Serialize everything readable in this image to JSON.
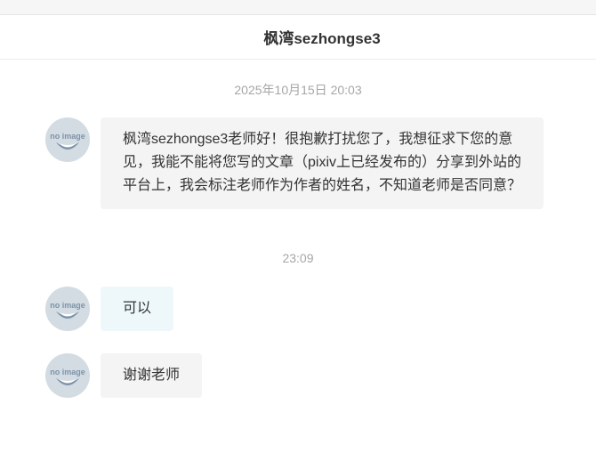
{
  "header": {
    "title": "枫湾sezhongse3"
  },
  "messages": [
    {
      "timestamp": "2025年10月15日 20:03",
      "avatar_text": "no image",
      "text": "枫湾sezhongse3老师好！很抱歉打扰您了，我想征求下您的意见，我能不能将您写的文章（pixiv上已经发布的）分享到外站的平台上，我会标注老师作为作者的姓名，不知道老师是否同意？"
    },
    {
      "timestamp": "23:09",
      "avatar_text": "no image",
      "text": "可以"
    },
    {
      "avatar_text": "no image",
      "text": "谢谢老师"
    }
  ],
  "colors": {
    "bubble_gray": "#f4f4f4",
    "bubble_blue": "#eef8fb",
    "avatar_bg": "#d3dbe3",
    "avatar_fg": "#7e93a8",
    "timestamp": "#a6a6a6"
  }
}
